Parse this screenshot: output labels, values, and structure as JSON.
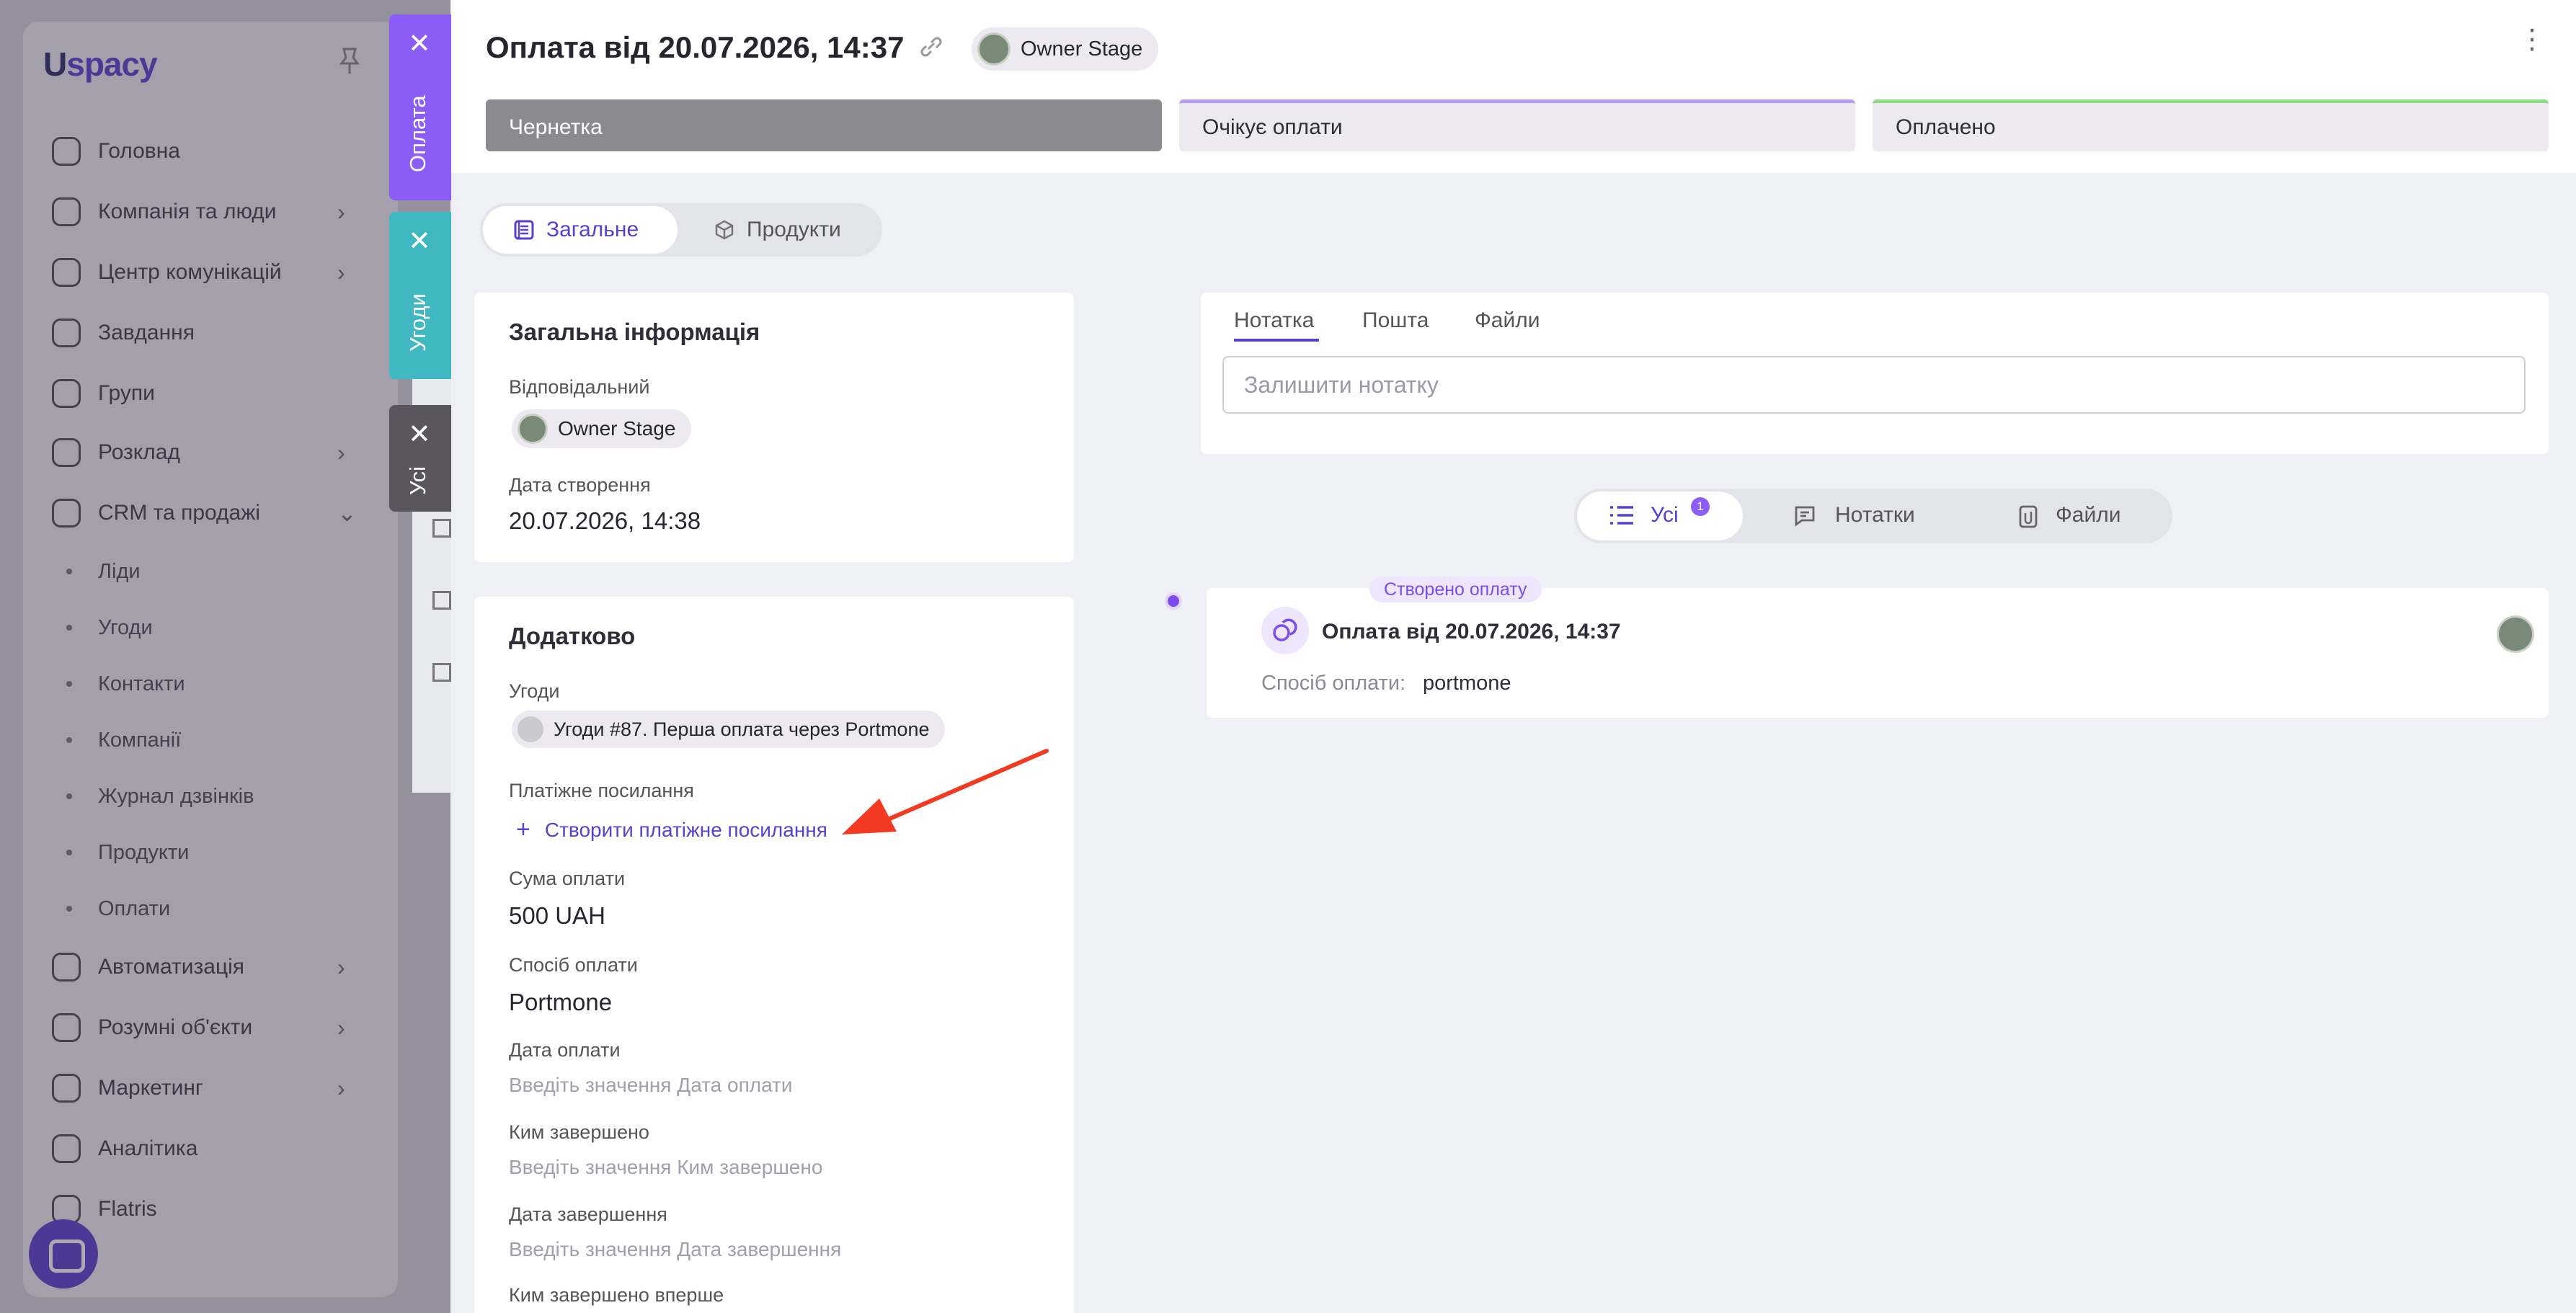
{
  "sidebar": {
    "logo_u": "U",
    "logo_rest": "spacy",
    "items": [
      {
        "label": "Головна",
        "icon": "home-icon"
      },
      {
        "label": "Компанія та люди",
        "icon": "building-icon"
      },
      {
        "label": "Центр комунікацій",
        "icon": "chat-icon"
      },
      {
        "label": "Завдання",
        "icon": "check-circle-icon"
      },
      {
        "label": "Групи",
        "icon": "users-icon"
      },
      {
        "label": "Розклад",
        "icon": "calendar-icon"
      },
      {
        "label": "CRM та продажі",
        "icon": "database-icon"
      }
    ],
    "subitems": [
      "Ліди",
      "Угоди",
      "Контакти",
      "Компанії",
      "Журнал дзвінків",
      "Продукти",
      "Оплати"
    ],
    "items2": [
      {
        "label": "Автоматизація",
        "icon": "lightning-icon"
      },
      {
        "label": "Розумні об'єкти",
        "icon": "scan-icon"
      },
      {
        "label": "Маркетинг",
        "icon": "megaphone-icon"
      },
      {
        "label": "Аналітика",
        "icon": "chart-icon"
      },
      {
        "label": "Flatris",
        "icon": "game-icon"
      }
    ]
  },
  "vtabs": [
    {
      "label": "Оплата",
      "color": "#8b5cf6"
    },
    {
      "label": "Угоди",
      "color": "#3fb8c2"
    },
    {
      "label": "Усі",
      "color": "#5a5660"
    }
  ],
  "header": {
    "title": "Оплата від 20.07.2026, 14:37",
    "owner": "Owner Stage",
    "stages": [
      {
        "label": "Чернетка",
        "bg": "#8a8a90",
        "text": "#ffffff",
        "bar": "#8a8a90"
      },
      {
        "label": "Очікує оплати",
        "bg": "#eceaf0",
        "text": "#2e2e38",
        "bar": "#b79cf7"
      },
      {
        "label": "Оплачено",
        "bg": "#eceaf0",
        "text": "#2e2e38",
        "bar": "#8fdc86"
      }
    ]
  },
  "tabs": {
    "general": "Загальне",
    "products": "Продукти"
  },
  "info": {
    "title": "Загальна інформація",
    "responsible_label": "Відповідальний",
    "responsible": "Owner Stage",
    "created_label": "Дата створення",
    "created": "20.07.2026, 14:38"
  },
  "extra": {
    "title": "Додатково",
    "deals_label": "Угоди",
    "deal": "Угоди #87. Перша оплата через Portmone",
    "paylink_label": "Платіжне посилання",
    "paylink_action": "Створити платіжне посилання",
    "sum_label": "Сума оплати",
    "sum": "500 UAH",
    "method_label": "Спосіб оплати",
    "method": "Portmone",
    "paydate_label": "Дата оплати",
    "paydate_ph": "Введіть значення Дата оплати",
    "by_label": "Ким завершено",
    "by_ph": "Введіть значення Ким завершено",
    "done_label": "Дата завершення",
    "done_ph": "Введіть значення Дата завершення",
    "first_label": "Ким завершено вперше"
  },
  "notes": {
    "tabs": [
      "Нотатка",
      "Пошта",
      "Файли"
    ],
    "placeholder": "Залишити нотатку"
  },
  "filter": {
    "all": "Усі",
    "all_count": "1",
    "notes": "Нотатки",
    "files": "Файли"
  },
  "event": {
    "badge": "Створено оплату",
    "title": "Оплата від 20.07.2026, 14:37",
    "method_label": "Спосіб оплати:",
    "method": "portmone"
  },
  "colors": {
    "accent": "#5b3fcf",
    "arrow": "#f23a22"
  }
}
